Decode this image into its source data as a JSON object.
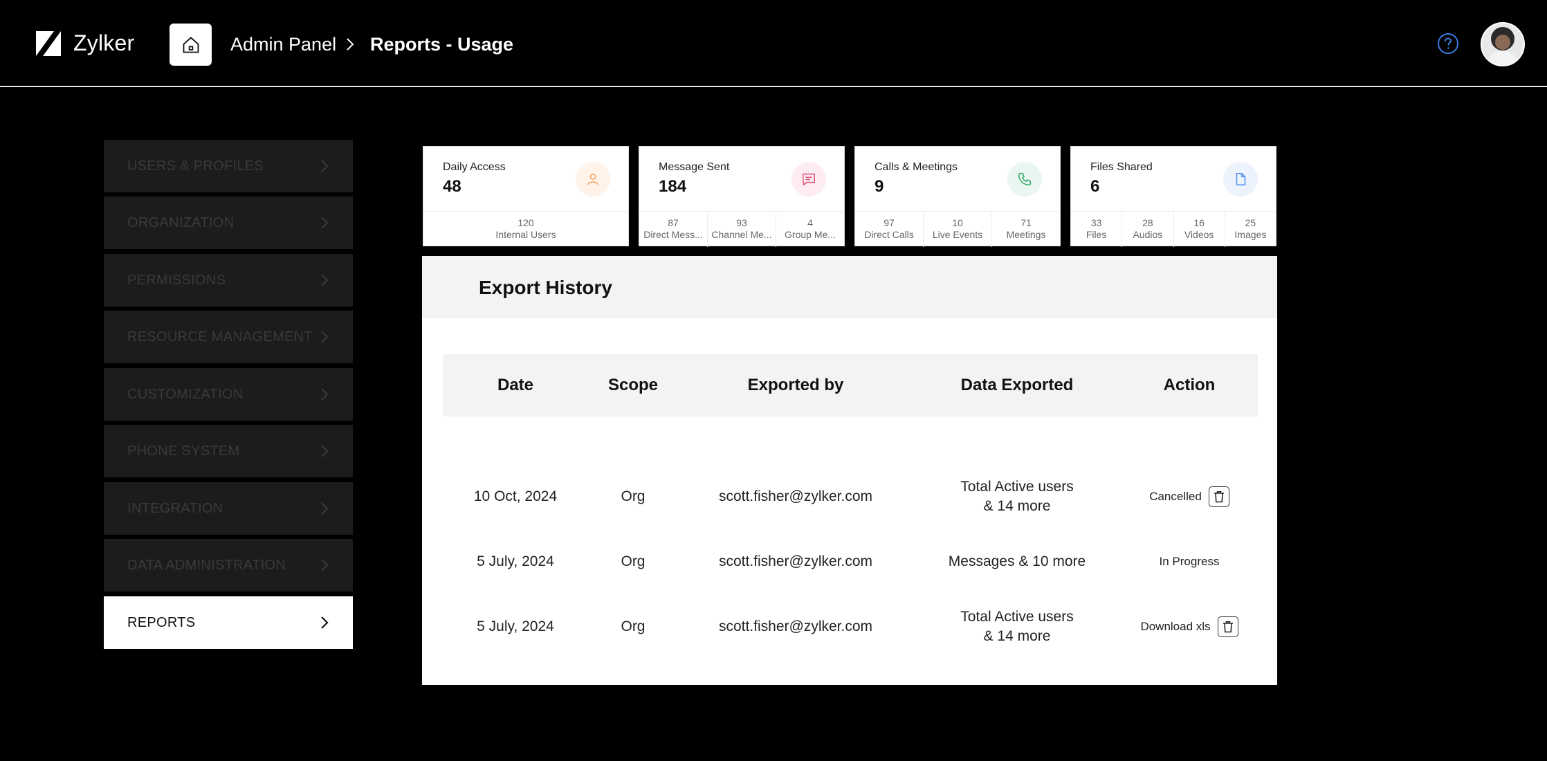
{
  "header": {
    "brand": "Zylker",
    "breadcrumb": {
      "parent": "Admin Panel",
      "separator": ">",
      "current": "Reports - Usage"
    }
  },
  "sidebar": {
    "items": [
      {
        "label": "USERS & PROFILES"
      },
      {
        "label": "ORGANIZATION"
      },
      {
        "label": "PERMISSIONS"
      },
      {
        "label": "RESOURCE MANAGEMENT"
      },
      {
        "label": "CUSTOMIZATION"
      },
      {
        "label": "PHONE SYSTEM"
      },
      {
        "label": "INTEGRATION"
      },
      {
        "label": "DATA ADMINISTRATION"
      },
      {
        "label": "REPORTS"
      }
    ],
    "active": "REPORTS"
  },
  "cards": [
    {
      "title": "Daily Access",
      "value": "48",
      "icon": "user-icon",
      "color": "#F5A25D",
      "bg": "#FFF3EA",
      "foot": [
        {
          "num": "120",
          "label": "Internal Users"
        }
      ]
    },
    {
      "title": "Message Sent",
      "value": "184",
      "icon": "chat-icon",
      "color": "#E0527A",
      "bg": "#FDEDF2",
      "foot": [
        {
          "num": "87",
          "label": "Direct Mess..."
        },
        {
          "num": "93",
          "label": "Channel Me..."
        },
        {
          "num": "4",
          "label": "Group Me..."
        }
      ]
    },
    {
      "title": "Calls & Meetings",
      "value": "9",
      "icon": "phone-icon",
      "color": "#2FA86B",
      "bg": "#EAF7F0",
      "foot": [
        {
          "num": "97",
          "label": "Direct Calls"
        },
        {
          "num": "10",
          "label": "Live Events"
        },
        {
          "num": "71",
          "label": "Meetings"
        }
      ]
    },
    {
      "title": "Files Shared",
      "value": "6",
      "icon": "file-icon",
      "color": "#4C8DF0",
      "bg": "#EDF3FD",
      "foot": [
        {
          "num": "33",
          "label": "Files"
        },
        {
          "num": "28",
          "label": "Audios"
        },
        {
          "num": "16",
          "label": "Videos"
        },
        {
          "num": "25",
          "label": "Images"
        }
      ]
    }
  ],
  "export": {
    "title": "Export History",
    "columns": {
      "date": "Date",
      "scope": "Scope",
      "by": "Exported by",
      "data": "Data Exported",
      "action": "Action"
    },
    "rows": [
      {
        "date": "10 Oct, 2024",
        "scope": "Org",
        "by": "scott.fisher@zylker.com",
        "data_line1": "Total Active users",
        "data_line2": "& 14 more",
        "action": "Cancelled",
        "deletable": true
      },
      {
        "date": "5 July, 2024",
        "scope": "Org",
        "by": "scott.fisher@zylker.com",
        "data_line1": "Messages & 10 more",
        "data_line2": "",
        "action": "In Progress",
        "deletable": false
      },
      {
        "date": "5 July, 2024",
        "scope": "Org",
        "by": "scott.fisher@zylker.com",
        "data_line1": "Total Active users",
        "data_line2": "& 14 more",
        "action": "Download xls",
        "deletable": true
      }
    ]
  },
  "colors": {
    "accent_help": "#3B7BE0",
    "sidebar_bg": "#1C1C1C",
    "sidebar_text": "#3A3A3A"
  }
}
